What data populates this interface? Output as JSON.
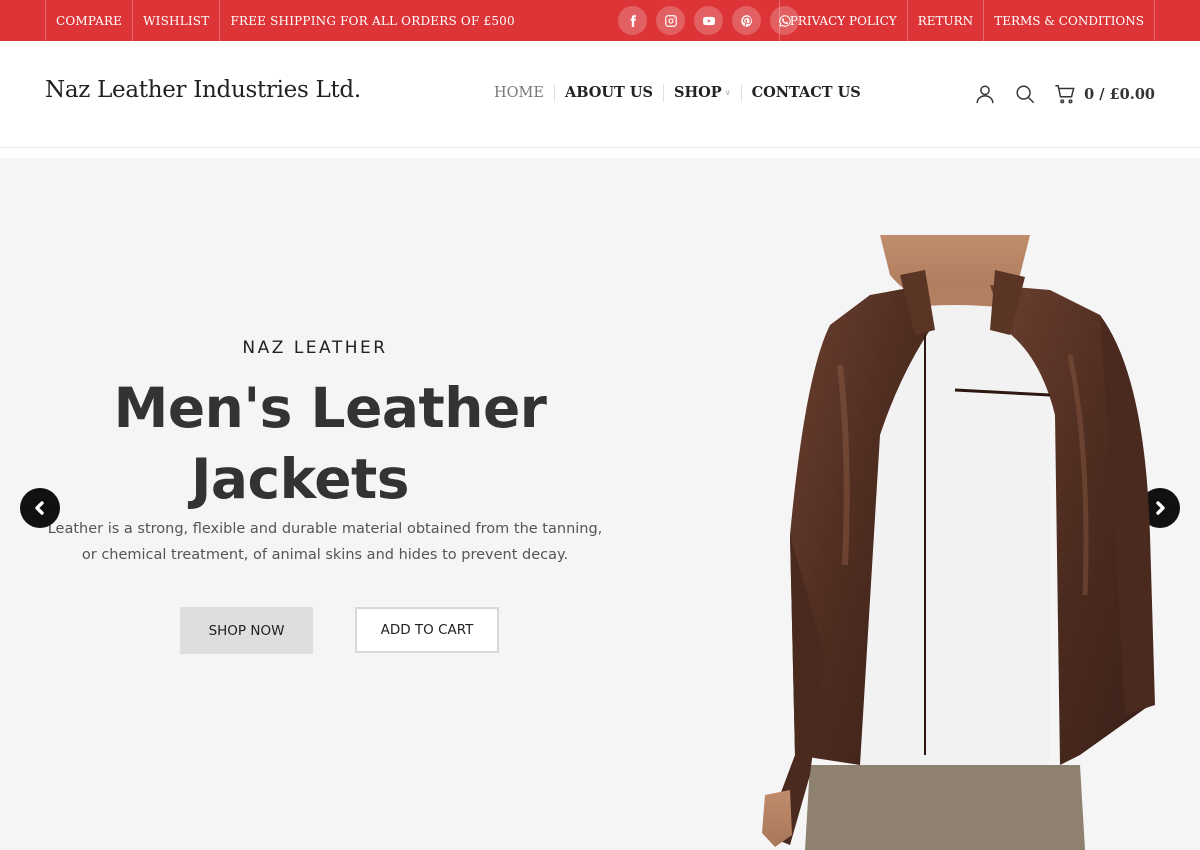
{
  "topbar": {
    "links_left": [
      "COMPARE",
      "WISHLIST",
      "FREE SHIPPING FOR ALL ORDERS OF £500"
    ],
    "socials": [
      "facebook-icon",
      "instagram-icon",
      "youtube-icon",
      "pinterest-icon",
      "whatsapp-icon"
    ],
    "links_right": [
      "PRIVACY POLICY",
      "RETURN",
      "TERMS & CONDITIONS"
    ],
    "background": "#dc3437"
  },
  "header": {
    "logo": "Naz Leather Industries Ltd.",
    "nav": [
      "HOME",
      "ABOUT US",
      "SHOP",
      "CONTACT US"
    ],
    "cart": "0 / £0.00"
  },
  "hero": {
    "kicker": "NAZ LEATHER",
    "title_line1": "Men's Leather",
    "title_line2": "Jackets",
    "desc_line1": "Leather is a strong, flexible and durable material obtained from the tanning,",
    "desc_line2": "or chemical treatment, of animal skins and hides to prevent decay.",
    "shop_now": "SHOP NOW",
    "add_to_cart": "ADD TO CART",
    "background": "#f5f5f5"
  }
}
